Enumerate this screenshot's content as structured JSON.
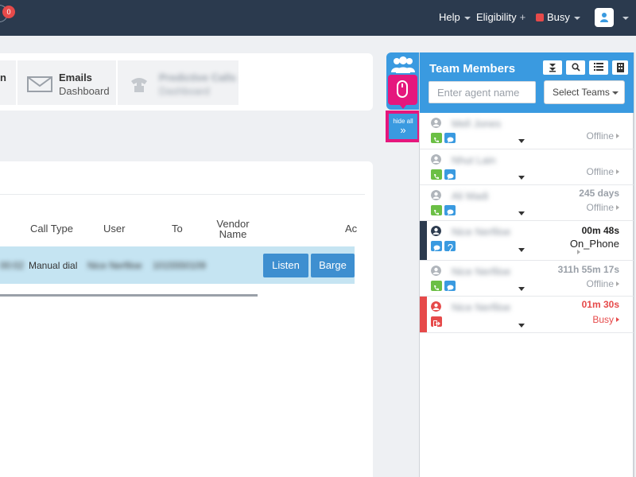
{
  "topbar": {
    "notification_count": "0",
    "help_label": "Help",
    "eligibility_label": "Eligibility",
    "status_label": "Busy"
  },
  "dashboards": {
    "partial_tile_label": "n",
    "emails": {
      "title": "Emails",
      "subtitle": "Dashboard"
    },
    "predictive": {
      "title": "Predictive Calls",
      "subtitle": "Dashboard"
    }
  },
  "calls_table": {
    "headers": {
      "call_type": "Call Type",
      "user": "User",
      "to": "To",
      "vendor_line1": "Vendor",
      "vendor_line2": "Name",
      "action_partial": "Ac"
    },
    "row": {
      "partial_cell": "00:02",
      "call_type": "Manual dial",
      "user": "Nice Nerfiloe",
      "to": "1015550109",
      "listen_label": "Listen",
      "barge_label": "Barge"
    }
  },
  "side_tab": {
    "hide_all_label": "hide all",
    "hide_all_arrow": "»"
  },
  "team_panel": {
    "title": "Team Members",
    "search_placeholder": "Enter agent name",
    "select_label": "Select Teams",
    "members": [
      {
        "name": "Mell Jones",
        "time": "",
        "status": "Offline"
      },
      {
        "name": "Nhut Lain",
        "time": "",
        "status": "Offline"
      },
      {
        "name": "Ali Madi",
        "time": "245 days",
        "status": "Offline"
      },
      {
        "name": "Nice Nerfiloe",
        "time": "00m 48s",
        "status": "On_Phone"
      },
      {
        "name": "Nice Nerfiloe",
        "time": "311h 55m 17s",
        "status": "Offline"
      },
      {
        "name": "Nice Nerfiloe",
        "time": "01m 30s",
        "status": "Busy"
      }
    ]
  },
  "colors": {
    "navbar": "#2b3a4e",
    "accent_blue": "#3a9ae0",
    "highlight_pink": "#e5177d",
    "busy_red": "#e64a4a",
    "phone_green": "#6bbf45",
    "row_highlight": "#c5e4f2"
  },
  "icons": {
    "notification": "bell-icon",
    "email": "envelope-icon",
    "team": "users-icon",
    "mouse": "mouse-icon",
    "phone": "phone-icon",
    "chat": "chat-icon",
    "listen": "ear-icon",
    "logout": "logout-icon"
  }
}
